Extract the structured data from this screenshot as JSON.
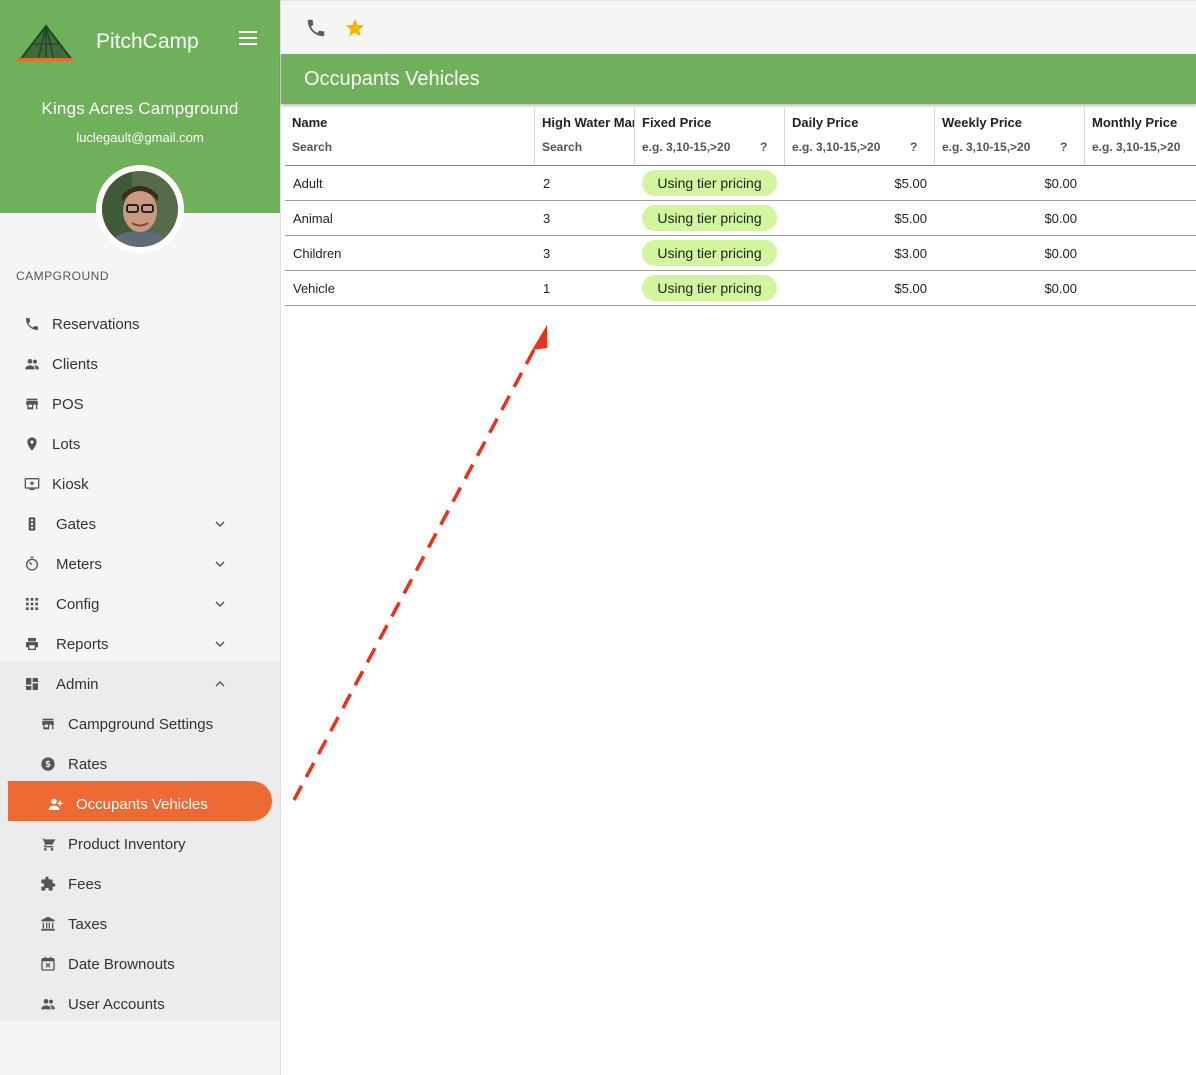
{
  "sidebar": {
    "brand": "PitchCamp",
    "campground_name": "Kings Acres Campground",
    "email": "luclegault@gmail.com",
    "section_label": "CAMPGROUND",
    "items": [
      {
        "label": "Reservations",
        "icon": "phone-icon"
      },
      {
        "label": "Clients",
        "icon": "people-icon"
      },
      {
        "label": "POS",
        "icon": "store-icon"
      },
      {
        "label": "Lots",
        "icon": "location-pin-icon"
      },
      {
        "label": "Kiosk",
        "icon": "kiosk-icon"
      },
      {
        "label": "Gates",
        "icon": "traffic-light-icon"
      },
      {
        "label": "Meters",
        "icon": "timer-icon"
      },
      {
        "label": "Config",
        "icon": "grid-icon"
      },
      {
        "label": "Reports",
        "icon": "printer-icon"
      },
      {
        "label": "Admin",
        "icon": "dashboard-icon"
      }
    ],
    "admin_items": [
      {
        "label": "Campground Settings",
        "icon": "store-icon"
      },
      {
        "label": "Rates",
        "icon": "dollar-icon"
      },
      {
        "label": "Occupants Vehicles",
        "icon": "person-add-icon"
      },
      {
        "label": "Product Inventory",
        "icon": "cart-icon"
      },
      {
        "label": "Fees",
        "icon": "puzzle-icon"
      },
      {
        "label": "Taxes",
        "icon": "bank-icon"
      },
      {
        "label": "Date Brownouts",
        "icon": "calendar-x-icon"
      },
      {
        "label": "User Accounts",
        "icon": "people-icon"
      }
    ]
  },
  "topbar": {
    "icons": [
      "phone-icon",
      "star-icon"
    ],
    "star_color": "#f2b705"
  },
  "page": {
    "title": "Occupants Vehicles"
  },
  "table": {
    "columns": [
      {
        "header": "Name",
        "filter": "Search"
      },
      {
        "header": "High Water Mark",
        "filter": "Search"
      },
      {
        "header": "Fixed Price",
        "filter": "e.g. 3,10-15,>20",
        "help": "?"
      },
      {
        "header": "Daily Price",
        "filter": "e.g. 3,10-15,>20",
        "help": "?"
      },
      {
        "header": "Weekly Price",
        "filter": "e.g. 3,10-15,>20",
        "help": "?"
      },
      {
        "header": "Monthly Price",
        "filter": "e.g. 3,10-15,>20",
        "help": "?"
      }
    ],
    "rows": [
      {
        "name": "Adult",
        "hwm": "2",
        "fixed": "Using tier pricing",
        "daily": "$5.00",
        "weekly": "$0.00"
      },
      {
        "name": "Animal",
        "hwm": "3",
        "fixed": "Using tier pricing",
        "daily": "$5.00",
        "weekly": "$0.00"
      },
      {
        "name": "Children",
        "hwm": "3",
        "fixed": "Using tier pricing",
        "daily": "$3.00",
        "weekly": "$0.00"
      },
      {
        "name": "Vehicle",
        "hwm": "1",
        "fixed": "Using tier pricing",
        "daily": "$5.00",
        "weekly": "$0.00"
      }
    ]
  },
  "colors": {
    "brand_green": "#6fb05a",
    "accent_orange": "#ee6a35",
    "chip_green": "#d2f59e",
    "annotation_red": "#e8321c"
  }
}
